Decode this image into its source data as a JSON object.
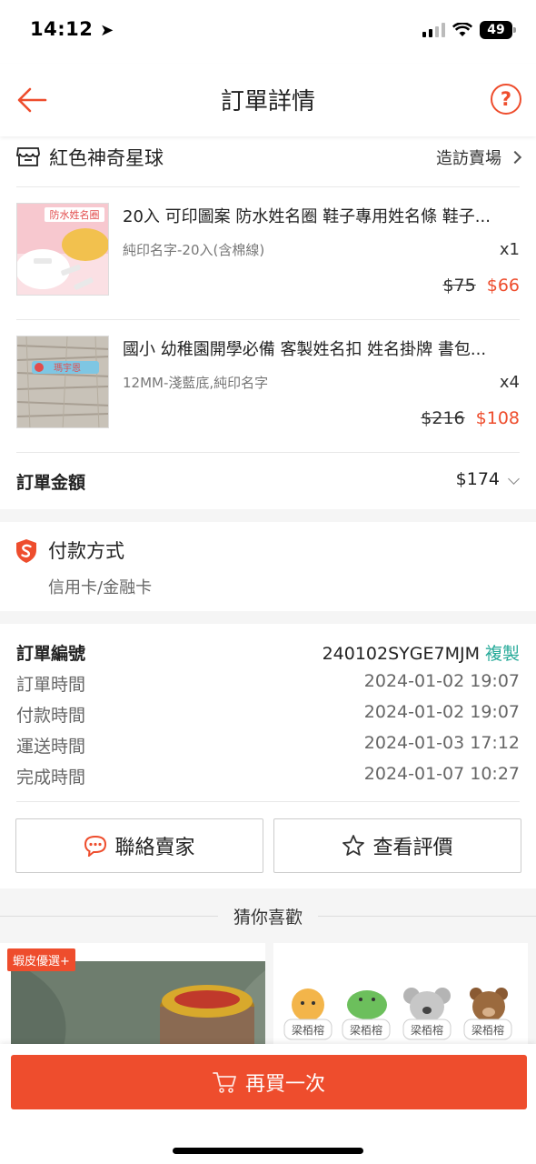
{
  "status": {
    "time": "14:12",
    "battery": "49"
  },
  "header": {
    "title": "訂單詳情",
    "help": "?"
  },
  "shop": {
    "name": "紅色神奇星球",
    "visit_label": "造訪賣場"
  },
  "products": [
    {
      "title": "20入 可印圖案 防水姓名圈 鞋子專用姓名條 鞋子...",
      "variant": "純印名字-20入(含棉線)",
      "qty": "x1",
      "original_price": "$75",
      "price": "$66",
      "thumb_text": "防水姓名圈"
    },
    {
      "title": "國小 幼稚園開學必備 客製姓名扣 姓名掛牌 書包...",
      "variant": "12MM-淺藍底,純印名字",
      "qty": "x4",
      "original_price": "$216",
      "price": "$108",
      "thumb_text": "瑪宇恩"
    }
  ],
  "total": {
    "label": "訂單金額",
    "value": "$174"
  },
  "payment": {
    "title": "付款方式",
    "method": "信用卡/金融卡"
  },
  "order_details": {
    "order_no_label": "訂單編號",
    "order_no": "240102SYGE7MJM",
    "copy_label": "複製",
    "rows": [
      {
        "label": "訂單時間",
        "value": "2024-01-02 19:07"
      },
      {
        "label": "付款時間",
        "value": "2024-01-02 19:07"
      },
      {
        "label": "運送時間",
        "value": "2024-01-03 17:12"
      },
      {
        "label": "完成時間",
        "value": "2024-01-07 10:27"
      }
    ]
  },
  "actions": {
    "contact_seller": "聯絡賣家",
    "view_review": "查看評價"
  },
  "recommend": {
    "title": "猜你喜歡",
    "badge": "蝦皮優選+",
    "tag_names": [
      "梁栢榕",
      "梁栢榕",
      "梁栢榕",
      "梁栢榕"
    ]
  },
  "bottom": {
    "buy_again": "再買一次"
  },
  "colors": {
    "accent": "#ee4d2d",
    "copy": "#26aa99"
  }
}
